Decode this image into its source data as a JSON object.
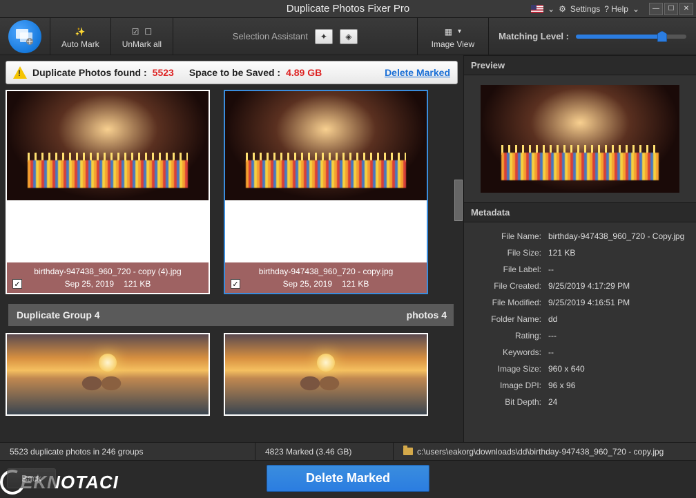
{
  "titlebar": {
    "title": "Duplicate Photos Fixer Pro",
    "settings": "Settings",
    "help": "? Help"
  },
  "toolbar": {
    "automark": "Auto Mark",
    "unmark": "UnMark all",
    "assistant": "Selection Assistant",
    "imageview": "Image View",
    "matching": "Matching Level :"
  },
  "infobar": {
    "found_label": "Duplicate Photos found :",
    "found_count": "5523",
    "space_label": "Space to be Saved :",
    "space_value": "4.89 GB",
    "delete_link": "Delete Marked"
  },
  "cards": [
    {
      "filename": "birthday-947438_960_720 - copy (4).jpg",
      "date": "Sep 25, 2019",
      "size": "121 KB",
      "checked": true
    },
    {
      "filename": "birthday-947438_960_720 - copy.jpg",
      "date": "Sep 25, 2019",
      "size": "121 KB",
      "checked": true
    }
  ],
  "group": {
    "title": "Duplicate Group 4",
    "count": "photos 4"
  },
  "right": {
    "preview": "Preview",
    "metadata": "Metadata",
    "rows": [
      {
        "k": "File Name:",
        "v": "birthday-947438_960_720 - Copy.jpg"
      },
      {
        "k": "File Size:",
        "v": "121 KB"
      },
      {
        "k": "File Label:",
        "v": "--"
      },
      {
        "k": "File Created:",
        "v": "9/25/2019 4:17:29 PM"
      },
      {
        "k": "File Modified:",
        "v": "9/25/2019 4:16:51 PM"
      },
      {
        "k": "Folder Name:",
        "v": "dd"
      },
      {
        "k": "Rating:",
        "v": "---"
      },
      {
        "k": "Keywords:",
        "v": "--"
      },
      {
        "k": "Image Size:",
        "v": "960 x 640"
      },
      {
        "k": "Image DPI:",
        "v": "96 x 96"
      },
      {
        "k": "Bit Depth:",
        "v": "24"
      }
    ]
  },
  "status": {
    "summary": "5523 duplicate photos in 246 groups",
    "marked": "4823 Marked (3.46 GB)",
    "path": "c:\\users\\eakorg\\downloads\\dd\\birthday-947438_960_720 - copy.jpg"
  },
  "bottom": {
    "back": "Back",
    "delete": "Delete Marked"
  },
  "watermark": "EKNOTACI"
}
